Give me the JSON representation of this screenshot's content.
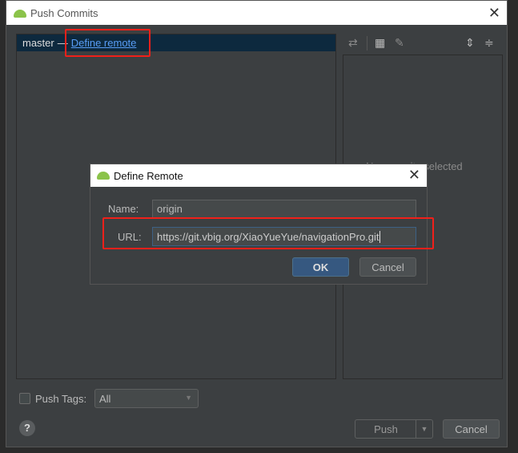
{
  "window": {
    "title": "Push Commits",
    "close": "✕"
  },
  "commits": {
    "branch": "master",
    "separator": "—",
    "define_remote": "Define remote"
  },
  "details": {
    "empty_text": "No commits selected"
  },
  "footer": {
    "push_tags_label": "Push Tags:",
    "push_tags_checked": false,
    "tags_select": "All",
    "push": "Push",
    "cancel": "Cancel",
    "help": "?"
  },
  "dialog": {
    "title": "Define Remote",
    "close": "✕",
    "name_label": "Name:",
    "name_value": "origin",
    "url_label": "URL:",
    "url_value": "https://git.vbig.org/XiaoYueYue/navigationPro.git",
    "ok": "OK",
    "cancel": "Cancel"
  },
  "colors": {
    "highlight": "#f0201a",
    "link": "#589df6",
    "selection": "#0d293e"
  }
}
